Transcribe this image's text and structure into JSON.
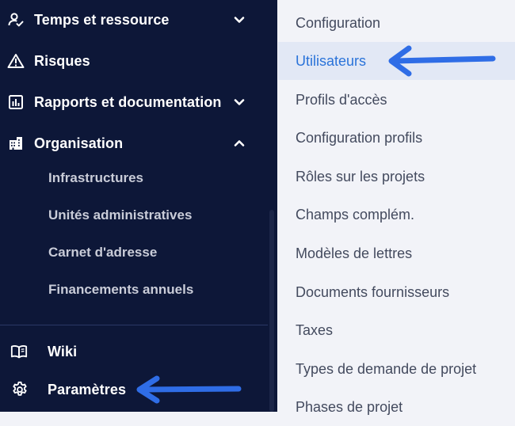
{
  "sidebar": {
    "items": [
      {
        "label": "Temps et ressource",
        "icon": "user-check-icon",
        "expanded": false
      },
      {
        "label": "Risques",
        "icon": "warning-icon"
      },
      {
        "label": "Rapports et documentation",
        "icon": "chart-report-icon",
        "expanded": false
      },
      {
        "label": "Organisation",
        "icon": "building-icon",
        "expanded": true
      }
    ],
    "subitems": [
      "Infrastructures",
      "Unités administratives",
      "Carnet d'adresse",
      "Financements annuels"
    ],
    "bottom": [
      {
        "label": "Wiki",
        "icon": "book-icon"
      },
      {
        "label": "Paramètres",
        "icon": "gear-icon"
      }
    ]
  },
  "settings_menu": {
    "active_index": 1,
    "items": [
      "Configuration",
      "Utilisateurs",
      "Profils d'accès",
      "Configuration profils",
      "Rôles sur les projets",
      "Champs complém.",
      "Modèles de lettres",
      "Documents fournisseurs",
      "Taxes",
      "Types de demande de projet",
      "Phases de projet"
    ]
  },
  "colors": {
    "sidebar_bg": "#0d1738",
    "menu_bg": "#f2f3f8",
    "active_bg": "#e2e8f5",
    "active_text": "#2a73d9",
    "annotation_arrow": "#2f6de6"
  }
}
